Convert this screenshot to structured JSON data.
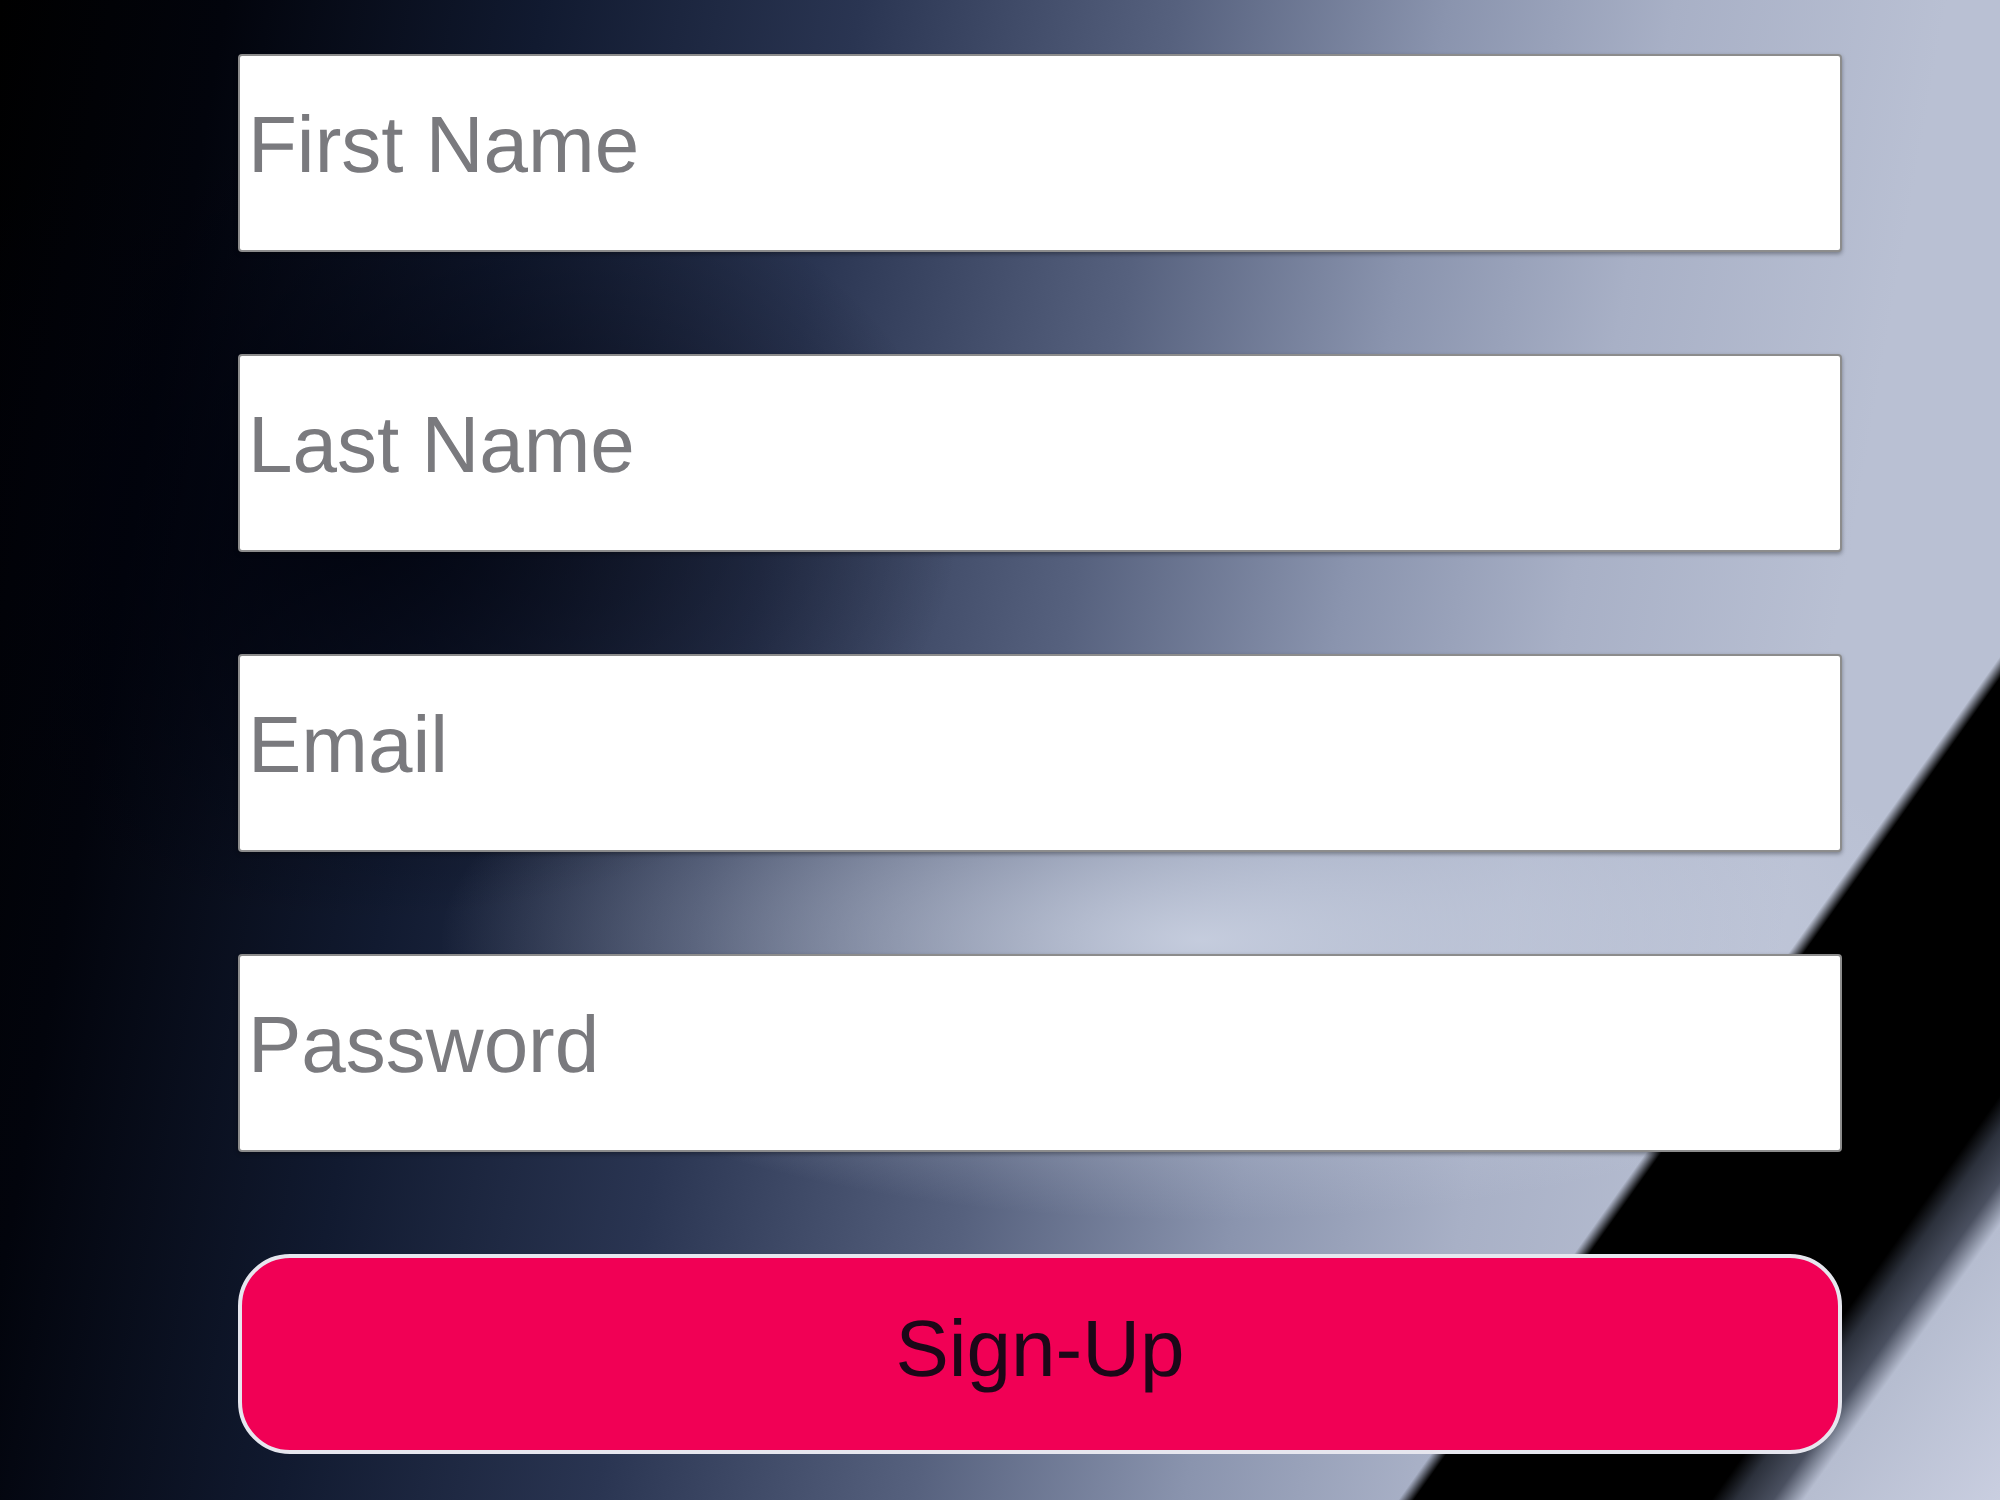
{
  "form": {
    "fields": [
      {
        "placeholder": "First Name"
      },
      {
        "placeholder": "Last Name"
      },
      {
        "placeholder": "Email"
      },
      {
        "placeholder": "Password"
      }
    ],
    "submit_button": {
      "label": "Sign-Up"
    }
  }
}
